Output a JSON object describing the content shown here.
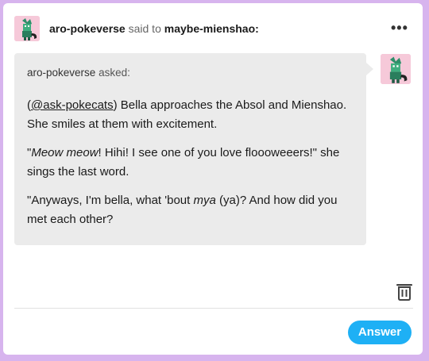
{
  "post": {
    "blog_name": "aro-pokeverse",
    "said_to": "said to",
    "target_blog": "maybe-mienshao:",
    "more_icon": "ellipsis-icon"
  },
  "ask": {
    "asker_name": "aro-pokeverse",
    "asked_label": "asked:",
    "paragraph1_open": "(",
    "mention": "@ask-pokecats",
    "paragraph1_rest": ") Bella approaches the Absol and Mienshao. She smiles at them with excitement.",
    "paragraph2_a": "\"",
    "paragraph2_italic": "Meow meow",
    "paragraph2_b": "! Hihi! I see one of you love floooweeers!\" she sings the last word.",
    "paragraph3_a": "\"Anyways, I'm bella, what 'bout ",
    "paragraph3_italic": "mya",
    "paragraph3_b": " (ya)? And how did you met each other?"
  },
  "actions": {
    "delete_icon": "trash-icon",
    "answer_label": "Answer"
  },
  "colors": {
    "background": "#d7b4ee",
    "bubble": "#ebebeb",
    "answer_button": "#1eb0f5"
  }
}
